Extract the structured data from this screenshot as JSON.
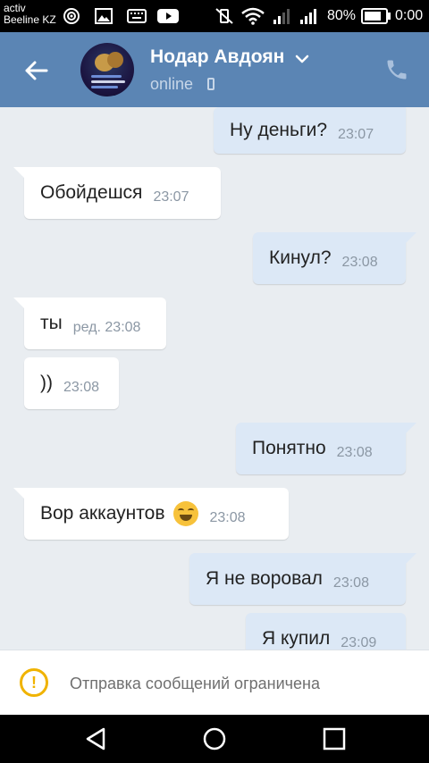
{
  "status_bar": {
    "carrier_line1": "activ",
    "carrier_line2": "Beeline KZ",
    "battery": "80%",
    "time": "0:00"
  },
  "header": {
    "contact_name": "Нодар Авдоян",
    "status": "online"
  },
  "messages": [
    {
      "dir": "out",
      "text": "Ну деньги?",
      "time": "23:07"
    },
    {
      "dir": "in",
      "text": "Обойдешся",
      "time": "23:07"
    },
    {
      "dir": "out",
      "text": "Кинул?",
      "time": "23:08"
    },
    {
      "dir": "in",
      "text": "ты",
      "time": "ред. 23:08"
    },
    {
      "dir": "in",
      "text": "))",
      "time": "23:08"
    },
    {
      "dir": "out",
      "text": "Понятно",
      "time": "23:08"
    },
    {
      "dir": "in",
      "text": "Вор аккаунтов",
      "time": "23:08",
      "emoji": "face-with-tears-of-joy"
    },
    {
      "dir": "out",
      "text": "Я не воровал",
      "time": "23:08"
    },
    {
      "dir": "out",
      "text": "Я купил",
      "time": "23:09"
    }
  ],
  "restriction": {
    "text": "Отправка сообщений ограничена",
    "color": "#f0b300"
  },
  "colors": {
    "header": "#5b85b4",
    "outgoing_bubble": "#dce8f6",
    "incoming_bubble": "#ffffff",
    "chat_background": "#e9edf1"
  }
}
